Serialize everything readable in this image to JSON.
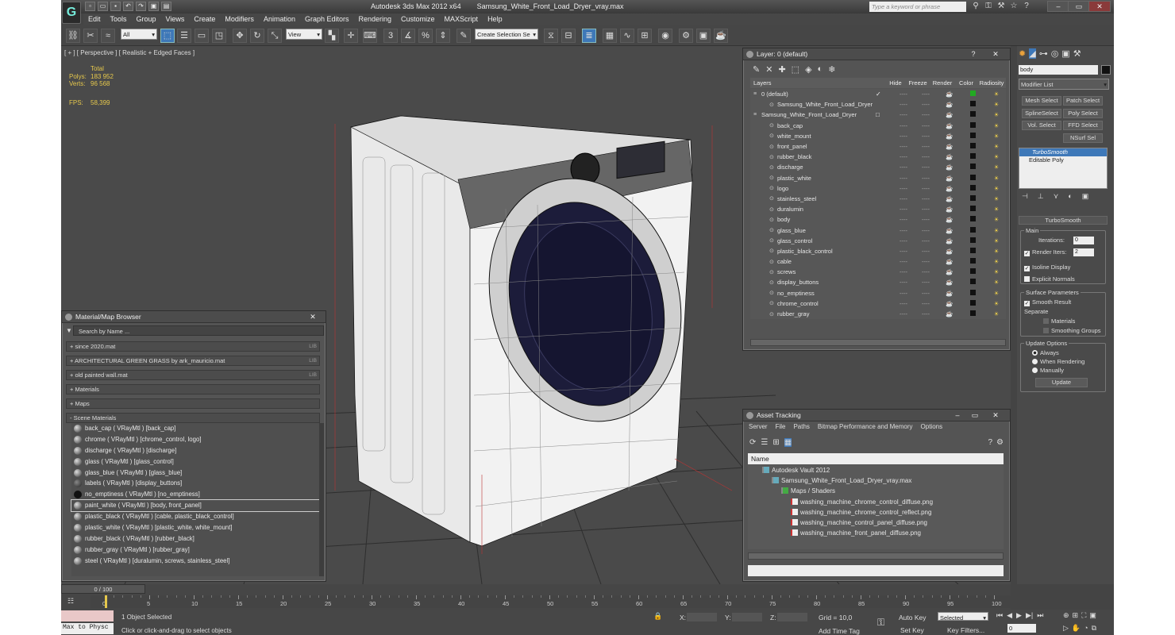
{
  "title": {
    "app": "Autodesk 3ds Max  2012 x64",
    "file": "Samsung_White_Front_Load_Dryer_vray.max",
    "search_placeholder": "Type a keyword or phrase"
  },
  "menu": [
    "Edit",
    "Tools",
    "Group",
    "Views",
    "Create",
    "Modifiers",
    "Animation",
    "Graph Editors",
    "Rendering",
    "Customize",
    "MAXScript",
    "Help"
  ],
  "toolbar": {
    "select_filter": "All",
    "ref_coord": "View",
    "named_sel": "Create Selection Se"
  },
  "viewport": {
    "label": "[ + ] [ Perspective ] [ Realistic + Edged Faces ]",
    "stats_total": "Total",
    "polys_label": "Polys:",
    "polys": "183 952",
    "verts_label": "Verts:",
    "verts": "96 568",
    "fps_label": "FPS:",
    "fps": "58,399"
  },
  "layer": {
    "title": "Layer: 0 (default)",
    "help": "?",
    "close": "✕",
    "headers": [
      "Layers",
      "Hide",
      "Freeze",
      "Render",
      "Color",
      "Radiosity"
    ],
    "rows": [
      {
        "name": "0 (default)",
        "lvl": 0,
        "check": "✓",
        "color": "#2a2"
      },
      {
        "name": "Samsung_White_Front_Load_Dryer",
        "lvl": 1
      },
      {
        "name": "Samsung_White_Front_Load_Dryer",
        "lvl": 0,
        "check": "□"
      },
      {
        "name": "back_cap",
        "lvl": 1
      },
      {
        "name": "white_mount",
        "lvl": 1
      },
      {
        "name": "front_panel",
        "lvl": 1
      },
      {
        "name": "rubber_black",
        "lvl": 1
      },
      {
        "name": "discharge",
        "lvl": 1
      },
      {
        "name": "plastic_white",
        "lvl": 1
      },
      {
        "name": "logo",
        "lvl": 1
      },
      {
        "name": "stainless_steel",
        "lvl": 1
      },
      {
        "name": "duralumin",
        "lvl": 1
      },
      {
        "name": "body",
        "lvl": 1
      },
      {
        "name": "glass_blue",
        "lvl": 1
      },
      {
        "name": "glass_control",
        "lvl": 1
      },
      {
        "name": "plastic_black_control",
        "lvl": 1
      },
      {
        "name": "cable",
        "lvl": 1
      },
      {
        "name": "screws",
        "lvl": 1
      },
      {
        "name": "display_buttons",
        "lvl": 1
      },
      {
        "name": "no_emptiness",
        "lvl": 1
      },
      {
        "name": "chrome_control",
        "lvl": 1
      },
      {
        "name": "rubber_gray",
        "lvl": 1
      }
    ]
  },
  "asset": {
    "title": "Asset Tracking",
    "menu": [
      "Server",
      "File",
      "Paths",
      "Bitmap Performance and Memory",
      "Options"
    ],
    "name_header": "Name",
    "rows": [
      {
        "t": "Autodesk Vault 2012",
        "ind": 18
      },
      {
        "t": "Samsung_White_Front_Load_Dryer_vray.max",
        "ind": 30
      },
      {
        "t": "Maps / Shaders",
        "ind": 42
      },
      {
        "t": "washing_machine_chrome_control_diffuse.png",
        "ind": 54
      },
      {
        "t": "washing_machine_chrome_control_reflect.png",
        "ind": 54
      },
      {
        "t": "washing_machine_control_panel_diffuse.png",
        "ind": 54
      },
      {
        "t": "washing_machine_front_panel_diffuse.png",
        "ind": 54
      }
    ]
  },
  "material": {
    "title": "Material/Map Browser",
    "search": "Search by Name ...",
    "lib_tag": "LIB",
    "libs": [
      "+ since 2020.mat",
      "+ ARCHITECTURAL GREEN GRASS by ark_mauricio.mat",
      "+ old painted wall.mat"
    ],
    "groups": [
      "+ Materials",
      "+ Maps",
      "- Scene Materials"
    ],
    "items": [
      "back_cap  ( VRayMtl ) [back_cap]",
      "chrome  ( VRayMtl ) [chrome_control, logo]",
      "discharge  ( VRayMtl ) [discharge]",
      "glass  ( VRayMtl ) [glass_control]",
      "glass_blue  ( VRayMtl ) [glass_blue]",
      "labels  ( VRayMtl ) [display_buttons]",
      "no_emptiness  ( VRayMtl ) [no_emptiness]",
      "paint_white  ( VRayMtl ) [body, front_panel]",
      "plastic_black  ( VRayMtl ) [cable, plastic_black_control]",
      "plastic_white  ( VRayMtl ) [plastic_white, white_mount]",
      "rubber_black  ( VRayMtl ) [rubber_black]",
      "rubber_gray  ( VRayMtl ) [rubber_gray]",
      "steel  ( VRayMtl ) [duralumin, screws, stainless_steel]"
    ]
  },
  "cmd": {
    "obj_name": "body",
    "modlist": "Modifier List",
    "buttons": [
      "Mesh Select",
      "Patch Select",
      "SplineSelect",
      "Poly Select",
      "Vol. Select",
      "FFD Select",
      "NSurf Sel"
    ],
    "stack": [
      "TurboSmooth",
      "Editable Poly"
    ],
    "roll": "TurboSmooth",
    "main": "Main",
    "iterations": "Iterations:",
    "iter_val": "0",
    "render_iters": "Render Iters:",
    "render_val": "2",
    "isoline": "Isoline Display",
    "explicit": "Explicit Normals",
    "surface": "Surface Parameters",
    "smooth": "Smooth Result",
    "separate": "Separate",
    "materials": "Materials",
    "smoothing": "Smoothing Groups",
    "update_opts": "Update Options",
    "always": "Always",
    "when": "When Rendering",
    "manually": "Manually",
    "update": "Update"
  },
  "timeline": {
    "frame": "0 / 100",
    "ticks": [
      "0",
      "5",
      "10",
      "15",
      "20",
      "25",
      "30",
      "35",
      "40",
      "45",
      "50",
      "55",
      "60",
      "65",
      "70",
      "75",
      "80",
      "85",
      "90",
      "95",
      "100"
    ]
  },
  "status": {
    "maxscript": "Max to Physc",
    "selected": "1 Object Selected",
    "prompt": "Click or click-and-drag to select objects",
    "x": "X:",
    "y": "Y:",
    "z": "Z:",
    "grid": "Grid = 10,0",
    "addtag": "Add Time Tag",
    "autokey": "Auto Key",
    "setkey": "Set Key",
    "selmode": "Selected",
    "keyfilters": "Key Filters...",
    "frame": "0"
  }
}
